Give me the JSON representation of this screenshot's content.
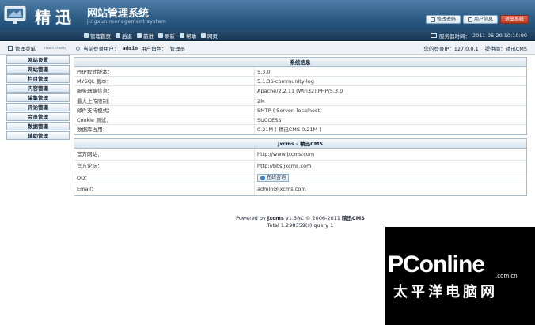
{
  "header": {
    "logo_main": "精迅",
    "logo_sub": "网站管理系统",
    "logo_en": "jingxun management system",
    "buttons": [
      {
        "label": "修改密码"
      },
      {
        "label": "用户信息"
      },
      {
        "label": "退出系统"
      }
    ]
  },
  "nav": {
    "items": [
      {
        "label": "管理首页"
      },
      {
        "label": "后退"
      },
      {
        "label": "前进"
      },
      {
        "label": "刷新"
      },
      {
        "label": "帮助"
      },
      {
        "label": "网页"
      }
    ],
    "server_time_label": "服务器时间：",
    "server_time": "2011-06-20 10:10:00"
  },
  "substrip": {
    "menu_title": "管理菜单",
    "menu_title_en": "main menu",
    "current_user_label": "当前登录用户：",
    "current_user": "admin",
    "role_label": "用户角色：",
    "role": "管理员",
    "login_ip_label": "您的登录IP：",
    "login_ip": "127.0.0.1",
    "provider_label": "提供商：",
    "provider": "精迅CMS"
  },
  "sidebar": {
    "items": [
      {
        "label": "网站设置"
      },
      {
        "label": "网站管理"
      },
      {
        "label": "栏目管理"
      },
      {
        "label": "内容管理"
      },
      {
        "label": "采集管理"
      },
      {
        "label": "评论管理"
      },
      {
        "label": "会员管理"
      },
      {
        "label": "数据管理"
      },
      {
        "label": "辅助管理"
      }
    ]
  },
  "system_info": {
    "title": "系统信息",
    "rows": [
      {
        "key": "PHP程式版本：",
        "value": "5.3.0"
      },
      {
        "key": "MYSQL 版本：",
        "value": "5.1.36-community-log"
      },
      {
        "key": "服务器端信息：",
        "value": "Apache/2.2.11 (Win32) PHP/5.3.0"
      },
      {
        "key": "最大上传限制：",
        "value": "2M"
      },
      {
        "key": "邮件支持模式：",
        "value": "SMTP ( Server: localhost)"
      },
      {
        "key": "Cookie 测试：",
        "value": "SUCCESS"
      },
      {
        "key": "数据库占用：",
        "value": "0.21M ( 精迅CMS 0.21M )"
      }
    ]
  },
  "cms_info": {
    "title": "jxcms - 精迅CMS",
    "rows": [
      {
        "key": "官方网站：",
        "value": "http://www.jxcms.com"
      },
      {
        "key": "官方论坛：",
        "value": "http://bbs.jxcms.com"
      },
      {
        "key": "QQ：",
        "value": "在线咨询"
      },
      {
        "key": "Email：",
        "value": "admin@jxcms.com"
      }
    ]
  },
  "footer": {
    "powered_prefix": "Powered by ",
    "powered_name": "jxcms",
    "powered_version": " v1.3RC  © 2006-2011 ",
    "powered_brand": "精迅CMS",
    "stats": "Total 1.298359(s) query 1"
  },
  "watermark": {
    "text": "PConline",
    "domain_suffix": ".com.cn",
    "subtitle": "太平洋电脑网"
  },
  "colors": {
    "header_bg": "#2f5e86",
    "nav_bg": "#183652",
    "logout_btn": "#b8361d"
  }
}
